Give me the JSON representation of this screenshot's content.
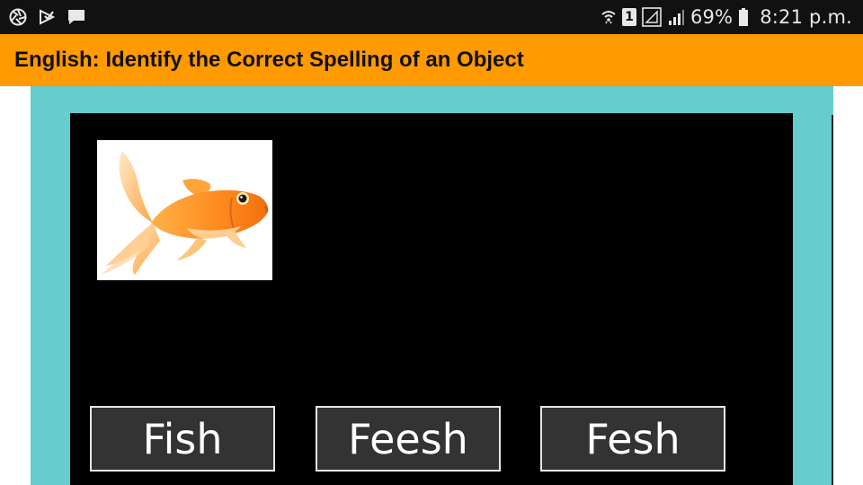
{
  "status_bar": {
    "left_icons": [
      "camera-shutter-icon",
      "media-icon",
      "message-icon"
    ],
    "right_icons": [
      "wifi-icon",
      "sim-1-icon",
      "signal-box-icon",
      "signal-bars-icon",
      "battery-icon"
    ],
    "sim_label": "1",
    "battery_percent": "69%",
    "time": "8:21 p.m."
  },
  "header": {
    "title": "English: Identify the Correct Spelling of an Object",
    "color": "#ff9a00"
  },
  "game": {
    "frame_color": "#66cccc",
    "canvas_color": "#000000",
    "picture_icon": "goldfish-image",
    "options": [
      "Fish",
      "Feesh",
      "Fesh"
    ]
  }
}
